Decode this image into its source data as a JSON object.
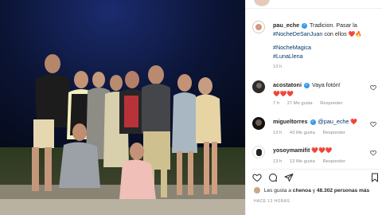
{
  "post": {
    "username": "pau_eche",
    "caption_text": "Tradicion. Pasar la",
    "caption_hashtag": "#NocheDeSanJuan",
    "caption_suffix": "con ellos",
    "caption_emojis": "❤️🔥",
    "tags_line1": "#NocheMagica",
    "tags_line2": "#LunaLlena",
    "time": "13 h"
  },
  "comments": [
    {
      "username": "acostatoni",
      "verified": true,
      "text": "Vaya fotón!",
      "emojis": "❤️❤️❤️",
      "time": "7 h",
      "likes": "27 Me gusta",
      "reply": "Responder"
    },
    {
      "username": "migueltorres",
      "verified": true,
      "mention": "@pau_eche",
      "emojis": "❤️",
      "time": "13 h",
      "likes": "43 Me gusta",
      "reply": "Responder"
    },
    {
      "username": "yosoymamifit",
      "verified": false,
      "emojis": "❤️❤️❤️",
      "time": "13 h",
      "likes": "13 Me gusta",
      "reply": "Responder"
    }
  ],
  "likes_text": {
    "prefix": "Les gusta a",
    "user": "chenoa",
    "joiner": "y",
    "count": "48.302 personas más"
  },
  "timestamp": "HACE 13 HORAS",
  "icons": [
    "heart-outline-icon",
    "comment-icon",
    "share-icon",
    "bookmark-icon"
  ],
  "colors": {
    "heart": "#ed2c3a",
    "verified": "#3897f0",
    "hashtag": "#00376b",
    "meta": "#8e8e8e"
  }
}
